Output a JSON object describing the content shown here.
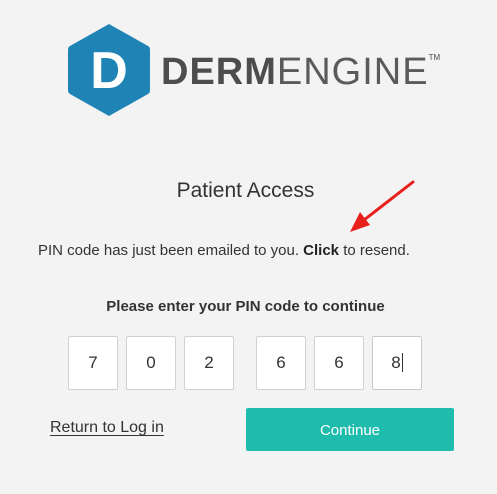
{
  "brand": {
    "logo_letter": "D",
    "name_bold": "DERM",
    "name_light": "ENGINE",
    "trademark": "TM",
    "color": "#1f84b5"
  },
  "page": {
    "title": "Patient Access",
    "info_prefix": "PIN code has just been emailed to you. ",
    "resend_link": "Click",
    "info_suffix": " to resend.",
    "pin_prompt": "Please enter your PIN code to continue"
  },
  "pin": {
    "digits": [
      "7",
      "0",
      "2",
      "6",
      "6",
      "8"
    ]
  },
  "actions": {
    "return_label": "Return to Log in",
    "continue_label": "Continue",
    "continue_color": "#1fbcae"
  },
  "annotation": {
    "arrow_color": "#e8201c"
  }
}
